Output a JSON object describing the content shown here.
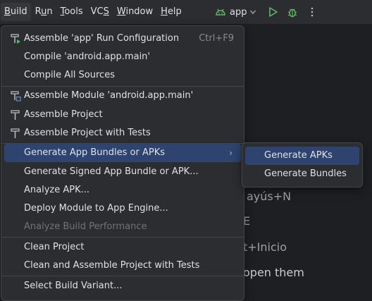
{
  "menubar": {
    "items": [
      {
        "label": "Build",
        "underline": "B"
      },
      {
        "label": "Run",
        "underline": "u"
      },
      {
        "label": "Tools",
        "underline": "T"
      },
      {
        "label": "VCS",
        "underline": "S"
      },
      {
        "label": "Window",
        "underline": "W"
      },
      {
        "label": "Help",
        "underline": "H"
      }
    ],
    "run_config_label": "app"
  },
  "build_menu": {
    "items": [
      {
        "label": "Assemble 'app' Run Configuration",
        "shortcut": "Ctrl+F9",
        "icon": "hammer-run-icon"
      },
      {
        "label": "Compile 'android.app.main'",
        "shortcut": "",
        "icon": ""
      },
      {
        "label": "Compile All Sources",
        "shortcut": "",
        "icon": ""
      },
      {
        "label": "Assemble Module 'android.app.main'",
        "shortcut": "",
        "icon": "hammer-module-icon"
      },
      {
        "label": "Assemble Project",
        "shortcut": "",
        "icon": "hammer-icon"
      },
      {
        "label": "Assemble Project with Tests",
        "shortcut": "",
        "icon": "hammer-icon"
      },
      {
        "label": "Generate App Bundles or APKs",
        "shortcut": "",
        "icon": "",
        "submenu": true
      },
      {
        "label": "Generate Signed App Bundle or APK...",
        "shortcut": "",
        "icon": ""
      },
      {
        "label": "Analyze APK...",
        "shortcut": "",
        "icon": ""
      },
      {
        "label": "Deploy Module to App Engine...",
        "shortcut": "",
        "icon": ""
      },
      {
        "label": "Analyze Build Performance",
        "shortcut": "",
        "icon": "",
        "disabled": true
      },
      {
        "label": "Clean Project",
        "shortcut": "",
        "icon": ""
      },
      {
        "label": "Clean and Assemble Project with Tests",
        "shortcut": "",
        "icon": ""
      },
      {
        "label": "Select Build Variant...",
        "shortcut": "",
        "icon": ""
      }
    ]
  },
  "submenu": {
    "items": [
      {
        "label": "Generate APKs"
      },
      {
        "label": "Generate Bundles"
      }
    ]
  },
  "editor_hints": {
    "line1": "ayús+N",
    "line2": "E",
    "line3": "t+Inicio",
    "line4": "open them"
  },
  "colors": {
    "menu_bg": "#2b2d30",
    "editor_bg": "#1e1f22",
    "highlight": "#2e436e",
    "run_green": "#5fb865"
  }
}
